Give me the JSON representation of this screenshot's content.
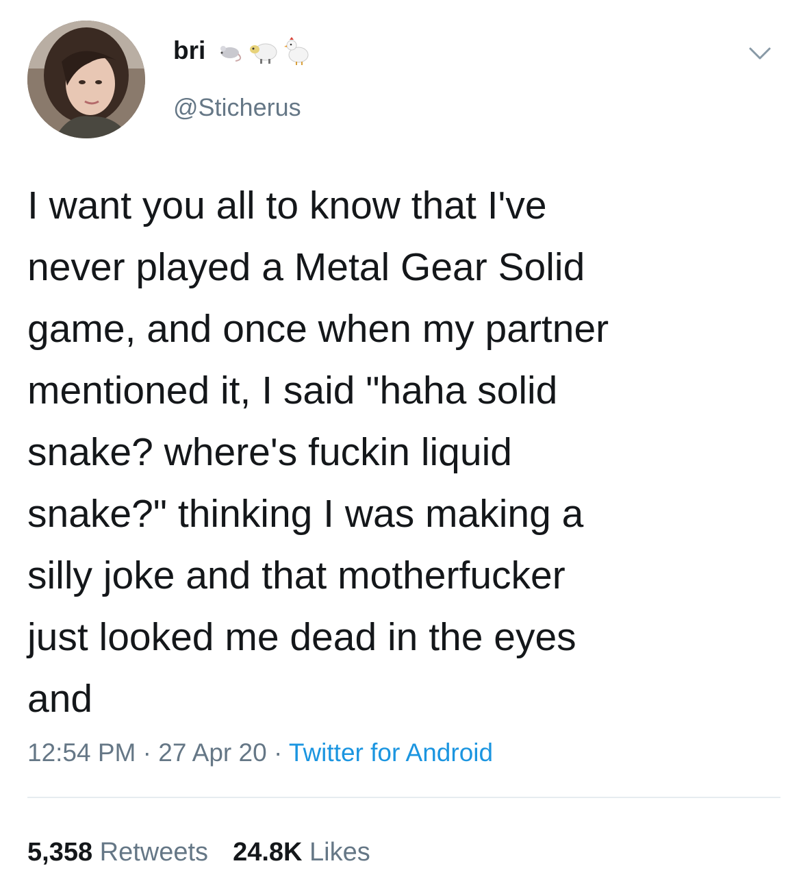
{
  "user": {
    "display_name": "bri",
    "handle": "@Sticherus",
    "name_emojis": [
      "mouse-icon",
      "sheep-icon",
      "chicken-icon"
    ]
  },
  "tweet": {
    "text": "I want you all to know that I've\nnever played a Metal Gear Solid\ngame, and once when my partner\nmentioned it, I said \"haha solid\nsnake? where's fuckin liquid\nsnake?\" thinking I was making a\nsilly joke and that motherfucker\njust looked me dead in the eyes\nand",
    "time": "12:54 PM",
    "separator": " · ",
    "date": "27 Apr 20",
    "source": "Twitter for Android"
  },
  "stats": {
    "retweets_count": "5,358",
    "retweets_label": "Retweets",
    "likes_count": "24.8K",
    "likes_label": "Likes"
  },
  "colors": {
    "text": "#14171a",
    "secondary": "#657786",
    "link": "#1b95e0",
    "divider": "#e6ecf0"
  }
}
